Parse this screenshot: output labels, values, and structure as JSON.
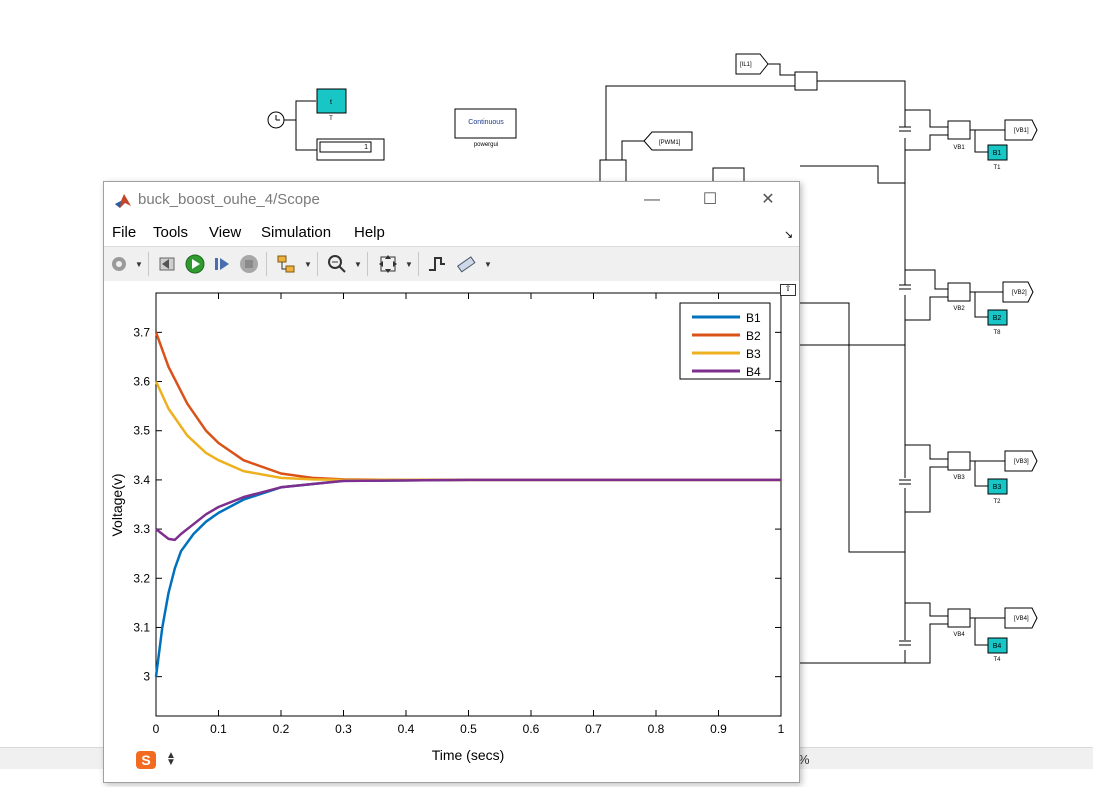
{
  "model": {
    "clock_block_label": "T",
    "clock_block_text": "t",
    "display_value": "1",
    "powergui_text": "Continuous",
    "powergui_label": "powergui",
    "goto_tags": [
      "[IL1]",
      "[PWM1]",
      "[VB1]",
      "[VB2]",
      "[VB3]",
      "[VB4]"
    ],
    "voltmeters": [
      "VB1",
      "VB2",
      "VB3",
      "VB4"
    ],
    "scope_blocks": [
      {
        "text": "B1",
        "label": "T1"
      },
      {
        "text": "B2",
        "label": "T8"
      },
      {
        "text": "B3",
        "label": "T2"
      },
      {
        "text": "B4",
        "label": "T4"
      }
    ],
    "colors": {
      "block_fill": "#19c6c6",
      "scope_bg": "#ffffff"
    }
  },
  "scope_window": {
    "title": "buck_boost_ouhe_4/Scope",
    "menus": [
      "File",
      "Tools",
      "View",
      "Simulation",
      "Help"
    ],
    "toolbar_icons": [
      "settings-icon",
      "step-back-icon",
      "run-icon",
      "step-forward-icon",
      "stop-icon",
      "highlight-block-icon",
      "zoom-icon",
      "fit-to-view-icon",
      "triggers-icon",
      "measurements-icon"
    ],
    "window_controls": [
      "minimize",
      "maximize",
      "close"
    ]
  },
  "status": {
    "zoom_suffix": "%"
  },
  "chart_data": {
    "type": "line",
    "xlabel": "Time (secs)",
    "ylabel": "Voltage(v)",
    "xlim": [
      0,
      1
    ],
    "ylim": [
      2.92,
      3.78
    ],
    "xticks": [
      "0",
      "0.1",
      "0.2",
      "0.3",
      "0.4",
      "0.5",
      "0.6",
      "0.7",
      "0.8",
      "0.9",
      "1"
    ],
    "yticks": [
      "3",
      "3.1",
      "3.2",
      "3.3",
      "3.4",
      "3.5",
      "3.6",
      "3.7"
    ],
    "legend_position": "top-right",
    "grid": false,
    "series": [
      {
        "name": "B1",
        "color": "#0072bd",
        "x": [
          0,
          0.01,
          0.02,
          0.03,
          0.04,
          0.06,
          0.08,
          0.1,
          0.14,
          0.2,
          0.3,
          0.5,
          1.0
        ],
        "y": [
          3.0,
          3.1,
          3.17,
          3.22,
          3.255,
          3.29,
          3.315,
          3.333,
          3.36,
          3.385,
          3.398,
          3.4,
          3.4
        ]
      },
      {
        "name": "B2",
        "color": "#d95319",
        "x": [
          0,
          0.02,
          0.05,
          0.08,
          0.1,
          0.14,
          0.2,
          0.25,
          0.3,
          0.4,
          0.5,
          1.0
        ],
        "y": [
          3.7,
          3.63,
          3.555,
          3.5,
          3.475,
          3.44,
          3.413,
          3.404,
          3.401,
          3.4,
          3.4,
          3.4
        ]
      },
      {
        "name": "B3",
        "color": "#edb120",
        "x": [
          0,
          0.02,
          0.05,
          0.08,
          0.1,
          0.14,
          0.2,
          0.25,
          0.3,
          0.5,
          1.0
        ],
        "y": [
          3.6,
          3.545,
          3.49,
          3.455,
          3.44,
          3.418,
          3.404,
          3.401,
          3.4,
          3.4,
          3.4
        ]
      },
      {
        "name": "B4",
        "color": "#7e2f8e",
        "x": [
          0,
          0.01,
          0.02,
          0.03,
          0.04,
          0.06,
          0.08,
          0.1,
          0.14,
          0.2,
          0.3,
          0.5,
          1.0
        ],
        "y": [
          3.3,
          3.29,
          3.28,
          3.278,
          3.29,
          3.31,
          3.33,
          3.345,
          3.365,
          3.385,
          3.398,
          3.4,
          3.4
        ]
      }
    ]
  }
}
